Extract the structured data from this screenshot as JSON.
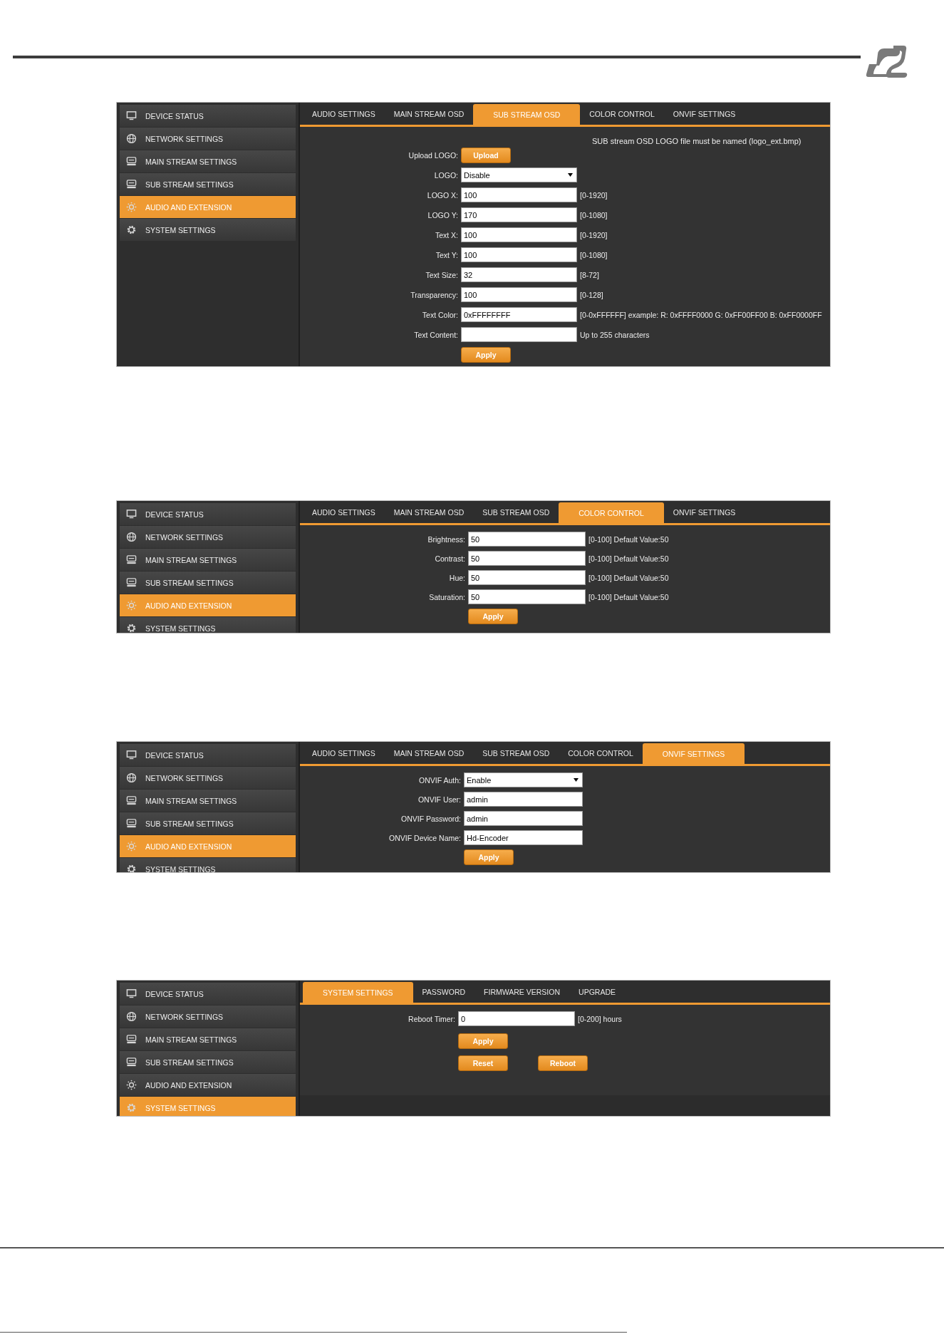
{
  "screens": [
    {
      "sidebar": [
        {
          "label": "DEVICE STATUS",
          "selected": false
        },
        {
          "label": "NETWORK SETTINGS",
          "selected": false
        },
        {
          "label": "MAIN STREAM SETTINGS",
          "selected": false
        },
        {
          "label": "SUB STREAM SETTINGS",
          "selected": false
        },
        {
          "label": "AUDIO AND EXTENSION",
          "selected": true
        },
        {
          "label": "SYSTEM SETTINGS",
          "selected": false
        }
      ],
      "tabs": [
        {
          "label": "AUDIO SETTINGS",
          "selected": false
        },
        {
          "label": "MAIN STREAM OSD",
          "selected": false
        },
        {
          "label": "SUB STREAM OSD",
          "selected": true
        },
        {
          "label": "COLOR CONTROL",
          "selected": false
        },
        {
          "label": "ONVIF SETTINGS",
          "selected": false
        }
      ],
      "note": "SUB stream OSD LOGO file must be named (logo_ext.bmp)",
      "rows": [
        {
          "kind": "upload",
          "label": "Upload LOGO:",
          "button": "Upload"
        },
        {
          "kind": "select",
          "label": "LOGO:",
          "value": "Disable"
        },
        {
          "kind": "text",
          "label": "LOGO X:",
          "value": "100",
          "hint": "[0-1920]"
        },
        {
          "kind": "text",
          "label": "LOGO Y:",
          "value": "170",
          "hint": "[0-1080]"
        },
        {
          "kind": "text",
          "label": "Text X:",
          "value": "100",
          "hint": "[0-1920]"
        },
        {
          "kind": "text",
          "label": "Text Y:",
          "value": "100",
          "hint": "[0-1080]"
        },
        {
          "kind": "text",
          "label": "Text Size:",
          "value": "32",
          "hint": "[8-72]"
        },
        {
          "kind": "text",
          "label": "Transparency:",
          "value": "100",
          "hint": "[0-128]"
        },
        {
          "kind": "text",
          "label": "Text Color:",
          "value": "0xFFFFFFFF",
          "hint": "[0-0xFFFFFF] example: R: 0xFFFF0000 G: 0xFF00FF00 B: 0xFF0000FF"
        },
        {
          "kind": "text",
          "label": "Text Content:",
          "hint": "Up to 255 characters"
        },
        {
          "kind": "buttons",
          "buttons": [
            "Apply"
          ]
        }
      ]
    },
    {
      "sidebar": [
        {
          "label": "DEVICE STATUS",
          "selected": false
        },
        {
          "label": "NETWORK SETTINGS",
          "selected": false
        },
        {
          "label": "MAIN STREAM SETTINGS",
          "selected": false
        },
        {
          "label": "SUB STREAM SETTINGS",
          "selected": false
        },
        {
          "label": "AUDIO AND EXTENSION",
          "selected": true
        },
        {
          "label": "SYSTEM SETTINGS",
          "selected": false
        }
      ],
      "tabs": [
        {
          "label": "AUDIO SETTINGS",
          "selected": false
        },
        {
          "label": "MAIN STREAM OSD",
          "selected": false
        },
        {
          "label": "SUB STREAM OSD",
          "selected": false
        },
        {
          "label": "COLOR CONTROL",
          "selected": true
        },
        {
          "label": "ONVIF SETTINGS",
          "selected": false
        }
      ],
      "rows": [
        {
          "kind": "text",
          "label": "Brightness:",
          "value": "50",
          "hint": "[0-100] Default Value:50"
        },
        {
          "kind": "text",
          "label": "Contrast:",
          "value": "50",
          "hint": "[0-100] Default Value:50"
        },
        {
          "kind": "text",
          "label": "Hue:",
          "value": "50",
          "hint": "[0-100] Default Value:50"
        },
        {
          "kind": "text",
          "label": "Saturation:",
          "value": "50",
          "hint": "[0-100] Default Value:50"
        },
        {
          "kind": "buttons",
          "buttons": [
            "Apply"
          ]
        }
      ]
    },
    {
      "sidebar": [
        {
          "label": "DEVICE STATUS",
          "selected": false
        },
        {
          "label": "NETWORK SETTINGS",
          "selected": false
        },
        {
          "label": "MAIN STREAM SETTINGS",
          "selected": false
        },
        {
          "label": "SUB STREAM SETTINGS",
          "selected": false
        },
        {
          "label": "AUDIO AND EXTENSION",
          "selected": true
        },
        {
          "label": "SYSTEM SETTINGS",
          "selected": false
        }
      ],
      "tabs": [
        {
          "label": "AUDIO SETTINGS",
          "selected": false
        },
        {
          "label": "MAIN STREAM OSD",
          "selected": false
        },
        {
          "label": "SUB STREAM OSD",
          "selected": false
        },
        {
          "label": "COLOR CONTROL",
          "selected": false
        },
        {
          "label": "ONVIF SETTINGS",
          "selected": true
        }
      ],
      "rows": [
        {
          "kind": "select",
          "label": "ONVIF Auth:",
          "value": "Enable"
        },
        {
          "kind": "text",
          "label": "ONVIF User:",
          "value": "admin"
        },
        {
          "kind": "text",
          "label": "ONVIF Password:",
          "value": "admin"
        },
        {
          "kind": "text",
          "label": "ONVIF Device Name:",
          "value": "Hd-Encoder"
        },
        {
          "kind": "buttons",
          "buttons": [
            "Apply"
          ]
        }
      ]
    },
    {
      "sidebar": [
        {
          "label": "DEVICE STATUS",
          "selected": false
        },
        {
          "label": "NETWORK SETTINGS",
          "selected": false
        },
        {
          "label": "MAIN STREAM SETTINGS",
          "selected": false
        },
        {
          "label": "SUB STREAM SETTINGS",
          "selected": false
        },
        {
          "label": "AUDIO AND EXTENSION",
          "selected": false
        },
        {
          "label": "SYSTEM SETTINGS",
          "selected": true
        }
      ],
      "tabs": [
        {
          "label": "SYSTEM SETTINGS",
          "selected": true
        },
        {
          "label": "PASSWORD",
          "selected": false
        },
        {
          "label": "FIRMWARE VERSION",
          "selected": false
        },
        {
          "label": "UPGRADE",
          "selected": false
        }
      ],
      "rows": [
        {
          "kind": "text",
          "label": "Reboot Timer:",
          "value": "0",
          "hint": "[0-200] hours"
        },
        {
          "kind": "buttons",
          "buttons": [
            "Apply"
          ]
        },
        {
          "kind": "buttons",
          "buttons": [
            "Reset",
            "Reboot"
          ]
        }
      ]
    }
  ]
}
